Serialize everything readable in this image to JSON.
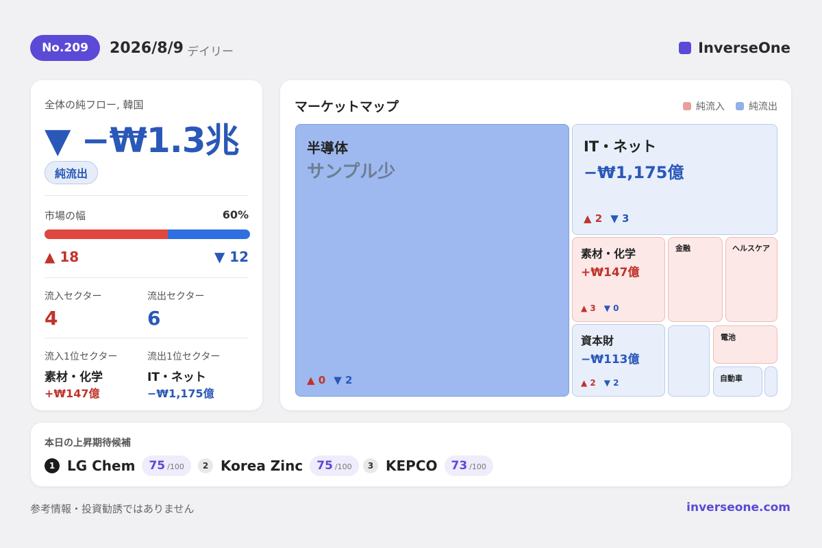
{
  "header": {
    "issue": "No.209",
    "date": "2026/8/9",
    "period": "デイリー",
    "brand": "InverseOne"
  },
  "summary": {
    "net_flow_label": "全体の純フロー, 韓国",
    "net_flow_value": "▼ −₩1.3兆",
    "net_flow_badge": "純流出",
    "breadth_label": "市場の幅",
    "breadth_pct": "60%",
    "breadth_up_fraction": 0.6,
    "up_count": "▲ 18",
    "down_count": "▼ 12",
    "inflow_sectors_label": "流入セクター",
    "inflow_sectors": "4",
    "outflow_sectors_label": "流出セクター",
    "outflow_sectors": "6",
    "top_inflow_label": "流入1位セクター",
    "top_inflow_name": "素材・化学",
    "top_inflow_value": "+₩147億",
    "top_outflow_label": "流出1位セクター",
    "top_outflow_name": "IT・ネット",
    "top_outflow_value": "−₩1,175億"
  },
  "market_map": {
    "title": "マーケットマップ",
    "legend_in": "純流入",
    "legend_out": "純流出",
    "colors": {
      "inflow": "#fbe8e7",
      "outflow": "#e8effb",
      "outflow_strong": "#9db9ef",
      "up": "#c0332b",
      "down": "#2a58b8"
    },
    "tiles": {
      "semis": {
        "name": "半導体",
        "note": "サンプル少",
        "up": "▲ 0",
        "down": "▼ 2"
      },
      "it": {
        "name": "IT・ネット",
        "value": "−₩1,175億",
        "up": "▲ 2",
        "down": "▼ 3"
      },
      "materials": {
        "name": "素材・化学",
        "value": "+₩147億",
        "up": "▲ 3",
        "down": "▼ 0"
      },
      "finance": {
        "name": "金融"
      },
      "health": {
        "name": "ヘルスケア"
      },
      "capital": {
        "name": "資本財",
        "value": "−₩113億",
        "up": "▲ 2",
        "down": "▼ 2"
      },
      "battery": {
        "name": "電池"
      },
      "auto": {
        "name": "自動車"
      }
    }
  },
  "candidates": {
    "title": "本日の上昇期待候補",
    "items": [
      {
        "rank": "1",
        "name": "LG Chem",
        "score": "75",
        "max": "/100"
      },
      {
        "rank": "2",
        "name": "Korea Zinc",
        "score": "75",
        "max": "/100"
      },
      {
        "rank": "3",
        "name": "KEPCO",
        "score": "73",
        "max": "/100"
      }
    ]
  },
  "footer": {
    "disclaimer": "参考情報・投資勧誘ではありません",
    "url": "inverseone.com"
  }
}
